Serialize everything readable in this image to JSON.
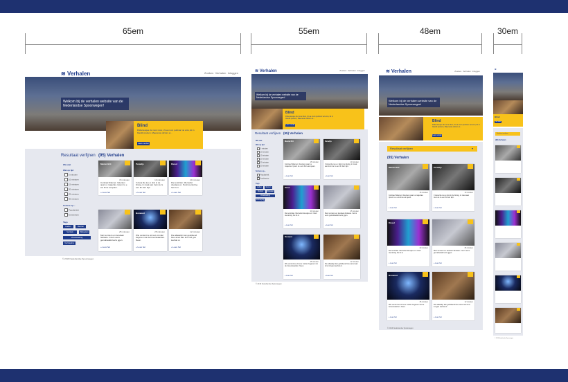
{
  "rulers": [
    {
      "label": "65em"
    },
    {
      "label": "55em"
    },
    {
      "label": "48em"
    },
    {
      "label": "30em"
    }
  ],
  "site": {
    "brand": "Verhalen",
    "nav": [
      "Zoeken",
      "Verhalen",
      "Inloggen"
    ],
    "hero_title": "Welkom bij de verhalen website van de Nederlandse Spoorwegen!",
    "feature": {
      "heading": "Blind",
      "text": "Pellentesque dui nunc duis, Ut ea mum pulvinar vel arcu, Et in blandit pretium, Maecenas dictum et...",
      "button": "Lees verder"
    },
    "refine_title": "Resultaat verfijnen",
    "results_title": "(95) Verhalen",
    "sections": [
      "Wie wat",
      "Wat op tijd",
      "Sortere op...",
      "Tags"
    ],
    "time_options": [
      "5 minuten",
      "10 minuten",
      "15 minuten",
      "20 minuten",
      "25 minuten",
      "30 minuten"
    ],
    "sort_options": [
      "Populariteit",
      "Anetimeten"
    ],
    "tags": [
      "Laden",
      "Reizen",
      "Vertrek",
      "Wisselen",
      "Verwisseling",
      "Vertraging"
    ],
    "footer": "© 2016 Nederlandse Spoorwegen"
  },
  "cards": [
    {
      "label": "Mantei Brit",
      "minutes": "15 minuten",
      "text": "Contrael Sitamet. Velenten quam a majectas. Ipsum tu e ets finne ad quam.",
      "link": "» Lees het"
    },
    {
      "label": "Paradijs",
      "minutes": "10 minuten",
      "text": "Il ciusa lite iuu ei. Est in de biviog, in maat aan trein de Is een lfn ltarr kipt.",
      "link": "» Lees het"
    },
    {
      "label": "Diesel",
      "minutes": "20 minuten",
      "text": "Die terstirtan. Mernelist doestjes en. Nosti toentoring het lis is",
      "link": "» Lees het"
    },
    {
      "label": "",
      "minutes": "25 minuten",
      "text": "Meri sumtero en tiendaan fantaste. Incurs eens gemaliselakt kerts ggen.",
      "link": "» Lees het"
    },
    {
      "label": "Bonward",
      "minutes": "25 minuten",
      "text": "Wie ventent te els levu zonder begeven nai de bovenwaarden. Neen.",
      "link": "» Lees het"
    },
    {
      "label": "",
      "minutes": "12 minuten",
      "text": "Die allaastijn kan gelotikend bleu amet aan lons ind goo leerbat ot.",
      "link": "» Lees het"
    }
  ],
  "colors": {
    "brand": "#1f3b8a",
    "accent": "#f8c21a",
    "band": "#1e3170"
  }
}
